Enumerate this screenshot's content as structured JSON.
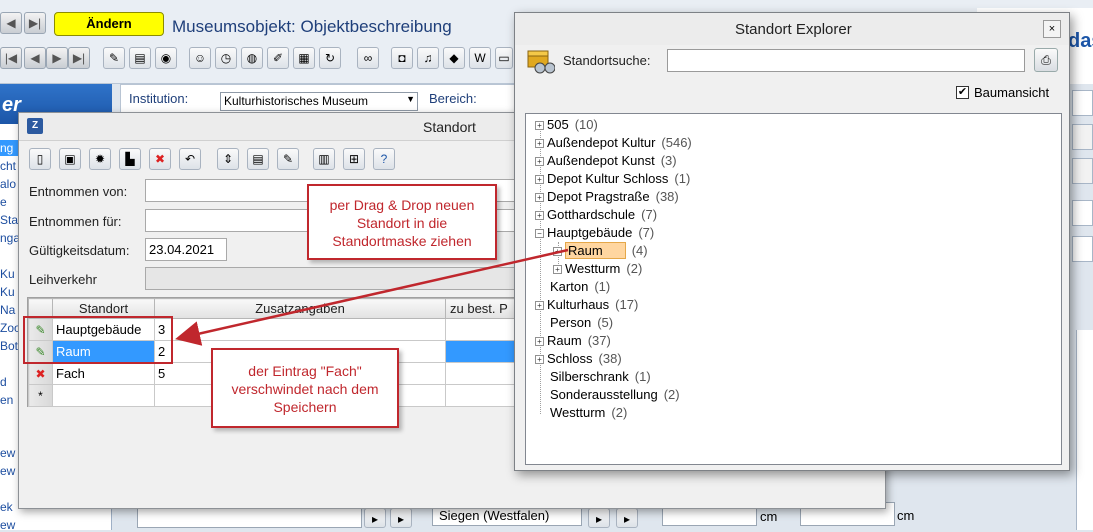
{
  "app": {
    "edit_button": "Ändern",
    "title": "Museumsobjekt: Objektbeschreibung",
    "institution_label": "Institution:",
    "institution_value": "Kulturhistorisches Museum",
    "bereich_label": "Bereich:",
    "sidebar_header": "er",
    "sidebar_items": [
      "ng",
      "cht",
      "alo",
      "e",
      "Sta",
      "nga",
      "Ku",
      "Ku",
      "Na",
      "Zoo",
      "Bot",
      "d",
      "en",
      "ew",
      "ew",
      "ek",
      "ew"
    ],
    "bottom_select_value": "Siegen (Westfalen)",
    "unit_cm_1": "cm",
    "unit_cm_2": "cm",
    "right_partial": "das"
  },
  "standort": {
    "title": "Standort",
    "app_icon": "Z",
    "entnommen_von_label": "Entnommen von:",
    "entnommen_fuer_label": "Entnommen für:",
    "gueltigkeitsdatum_label": "Gültigkeitsdatum:",
    "gueltigkeitsdatum_value": "23.04.2021",
    "leihverkehr_label": "Leihverkehr",
    "grid": {
      "headers": [
        "Standort",
        "Zusatzangaben",
        "zu best. P"
      ],
      "rows": [
        {
          "icon": "✎",
          "standort": "Hauptgebäude",
          "zusatz": "3"
        },
        {
          "icon": "✎",
          "standort": "Raum",
          "zusatz": "2"
        },
        {
          "icon": "✖",
          "standort": "Fach",
          "zusatz": "5"
        },
        {
          "icon": "*",
          "standort": "",
          "zusatz": ""
        }
      ]
    }
  },
  "explorer": {
    "title": "Standort Explorer",
    "close": "×",
    "search_label": "Standortsuche:",
    "baumansicht_label": "Baumansicht",
    "baumansicht_checked": "✔",
    "tree": [
      {
        "label": "505",
        "count": "(10)",
        "expand": "+"
      },
      {
        "label": "Außendepot Kultur",
        "count": "(546)",
        "expand": "+"
      },
      {
        "label": "Außendepot Kunst",
        "count": "(3)",
        "expand": "+"
      },
      {
        "label": "Depot Kultur Schloss",
        "count": "(1)",
        "expand": "+"
      },
      {
        "label": "Depot Pragstraße",
        "count": "(38)",
        "expand": "+"
      },
      {
        "label": "Gotthardschule",
        "count": "(7)",
        "expand": "+"
      },
      {
        "label": "Hauptgebäude",
        "count": "(7)",
        "expand": "−"
      },
      {
        "label": "Raum",
        "count": "(4)",
        "expand": "+"
      },
      {
        "label": "Westturm",
        "count": "(2)",
        "expand": "+"
      },
      {
        "label": "Karton",
        "count": "(1)",
        "expand": ""
      },
      {
        "label": "Kulturhaus",
        "count": "(17)",
        "expand": "+"
      },
      {
        "label": "Person",
        "count": "(5)",
        "expand": ""
      },
      {
        "label": "Raum",
        "count": "(37)",
        "expand": "+"
      },
      {
        "label": "Schloss",
        "count": "(38)",
        "expand": "+"
      },
      {
        "label": "Silberschrank",
        "count": "(1)",
        "expand": ""
      },
      {
        "label": "Sonderausstellung",
        "count": "(2)",
        "expand": ""
      },
      {
        "label": "Westturm",
        "count": "(2)",
        "expand": ""
      }
    ]
  },
  "callouts": {
    "drag_drop": "per Drag & Drop neuen Standort in die Standortmaske ziehen",
    "fach": "der Eintrag \"Fach\" verschwindet nach dem Speichern"
  },
  "colors": {
    "accent": "#1f3f7a",
    "callout": "#c0272d",
    "selection": "#3399ff",
    "highlight": "#ffd6a0",
    "edit_button": "#ffff00"
  }
}
